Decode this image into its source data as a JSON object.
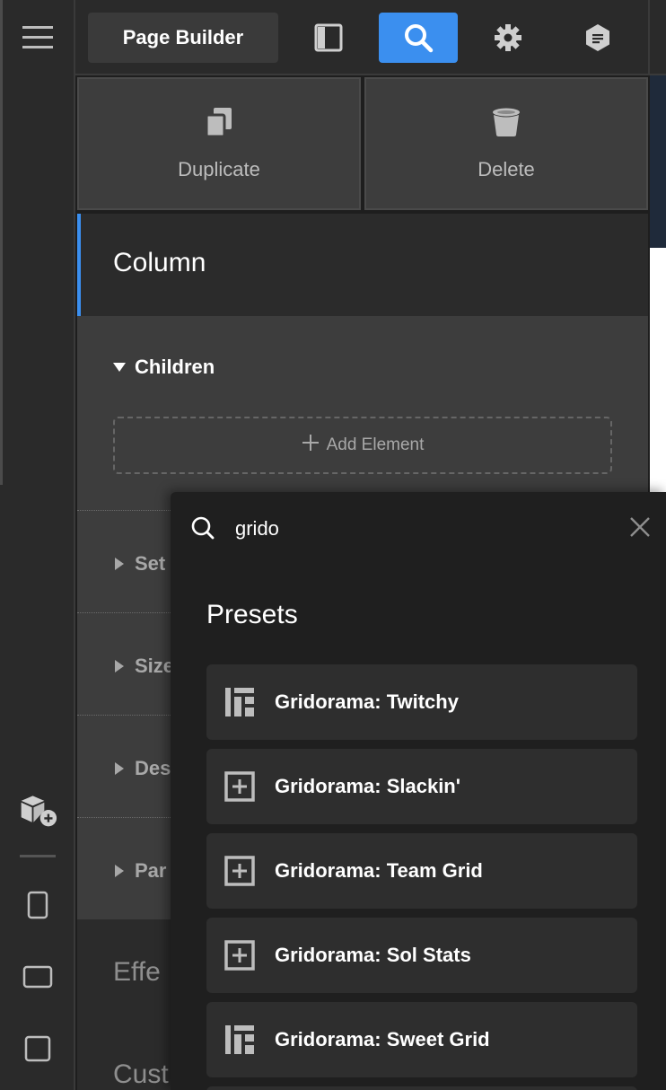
{
  "toolbar": {
    "page_builder_label": "Page Builder",
    "icons": [
      "layout-icon",
      "search-icon",
      "gear-icon",
      "notes-icon"
    ],
    "active_icon": "search-icon",
    "accent": "#3b8fef"
  },
  "actions": {
    "duplicate_label": "Duplicate",
    "delete_label": "Delete"
  },
  "panel": {
    "title": "Column",
    "children_label": "Children",
    "add_element_label": "Add Element",
    "sections": [
      "Set",
      "Size",
      "Des",
      "Par"
    ],
    "lower_sections": [
      "Effe",
      "Cust"
    ]
  },
  "search": {
    "value": "grido",
    "presets_heading": "Presets",
    "results": [
      {
        "label": "Gridorama: Twitchy",
        "icon": "grid-layout-icon"
      },
      {
        "label": "Gridorama: Slackin'",
        "icon": "plus-box-icon"
      },
      {
        "label": "Gridorama: Team Grid",
        "icon": "plus-box-icon"
      },
      {
        "label": "Gridorama: Sol Stats",
        "icon": "plus-box-icon"
      },
      {
        "label": "Gridorama: Sweet Grid",
        "icon": "grid-layout-icon"
      }
    ]
  },
  "rail": {
    "icons": [
      "menu-icon",
      "add-component-icon",
      "phone-icon",
      "tablet-landscape-icon",
      "desktop-icon"
    ]
  }
}
